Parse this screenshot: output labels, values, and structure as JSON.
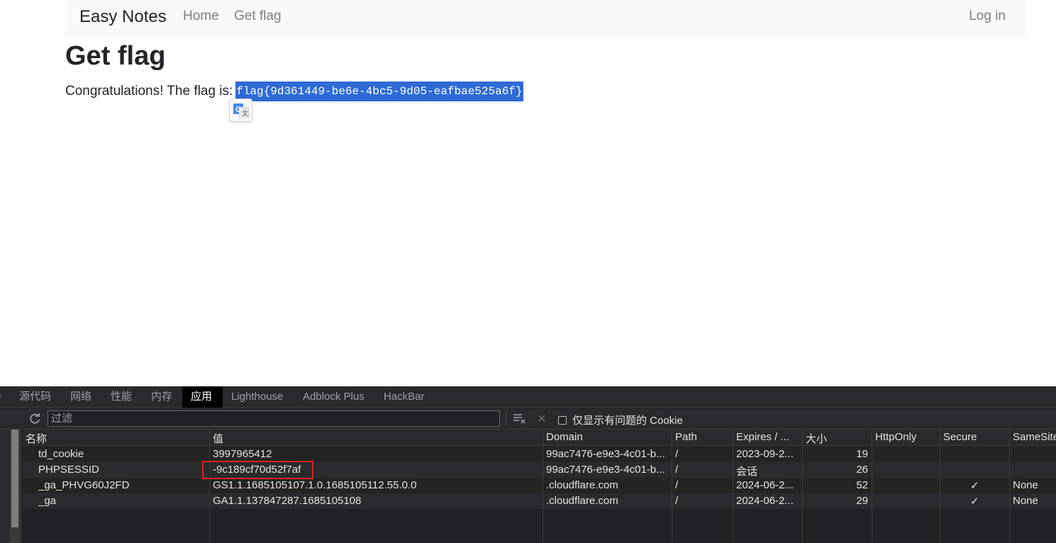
{
  "navbar": {
    "brand": "Easy Notes",
    "home": "Home",
    "get_flag": "Get flag",
    "login": "Log in"
  },
  "page": {
    "title": "Get flag",
    "message": "Congratulations! The flag is:",
    "flag": "flag{9d361449-be6e-4bc5-9d05-eafbae525a6f}"
  },
  "devtools": {
    "tabs": [
      "源代码",
      "网络",
      "性能",
      "内存",
      "应用",
      "Lighthouse",
      "Adblock Plus",
      "HackBar"
    ],
    "active_tab": "应用",
    "filter_placeholder": "过滤",
    "only_issues_label": "仅显示有问题的 Cookie",
    "columns": [
      "名称",
      "值",
      "Domain",
      "Path",
      "Expires / ...",
      "大小",
      "HttpOnly",
      "Secure",
      "SameSite"
    ],
    "cookies": [
      {
        "name": "td_cookie",
        "value": "3997965412",
        "domain": "99ac7476-e9e3-4c01-b...",
        "path": "/",
        "expires": "2023-09-2...",
        "size": "19",
        "httponly": "",
        "secure": "",
        "samesite": ""
      },
      {
        "name": "PHPSESSID",
        "value": "-9c189cf70d52f7af",
        "domain": "99ac7476-e9e3-4c01-b...",
        "path": "/",
        "expires": "会话",
        "size": "26",
        "httponly": "",
        "secure": "",
        "samesite": ""
      },
      {
        "name": "_ga_PHVG60J2FD",
        "value": "GS1.1.1685105107.1.0.1685105112.55.0.0",
        "domain": ".cloudflare.com",
        "path": "/",
        "expires": "2024-06-2...",
        "size": "52",
        "httponly": "",
        "secure": "✓",
        "samesite": "None"
      },
      {
        "name": "_ga",
        "value": "GA1.1.137847287.1685105108",
        "domain": ".cloudflare.com",
        "path": "/",
        "expires": "2024-06-2...",
        "size": "29",
        "httponly": "",
        "secure": "✓",
        "samesite": "None"
      }
    ],
    "colors": {
      "highlight": "#e02020",
      "selection": "#2e6ad6"
    }
  }
}
